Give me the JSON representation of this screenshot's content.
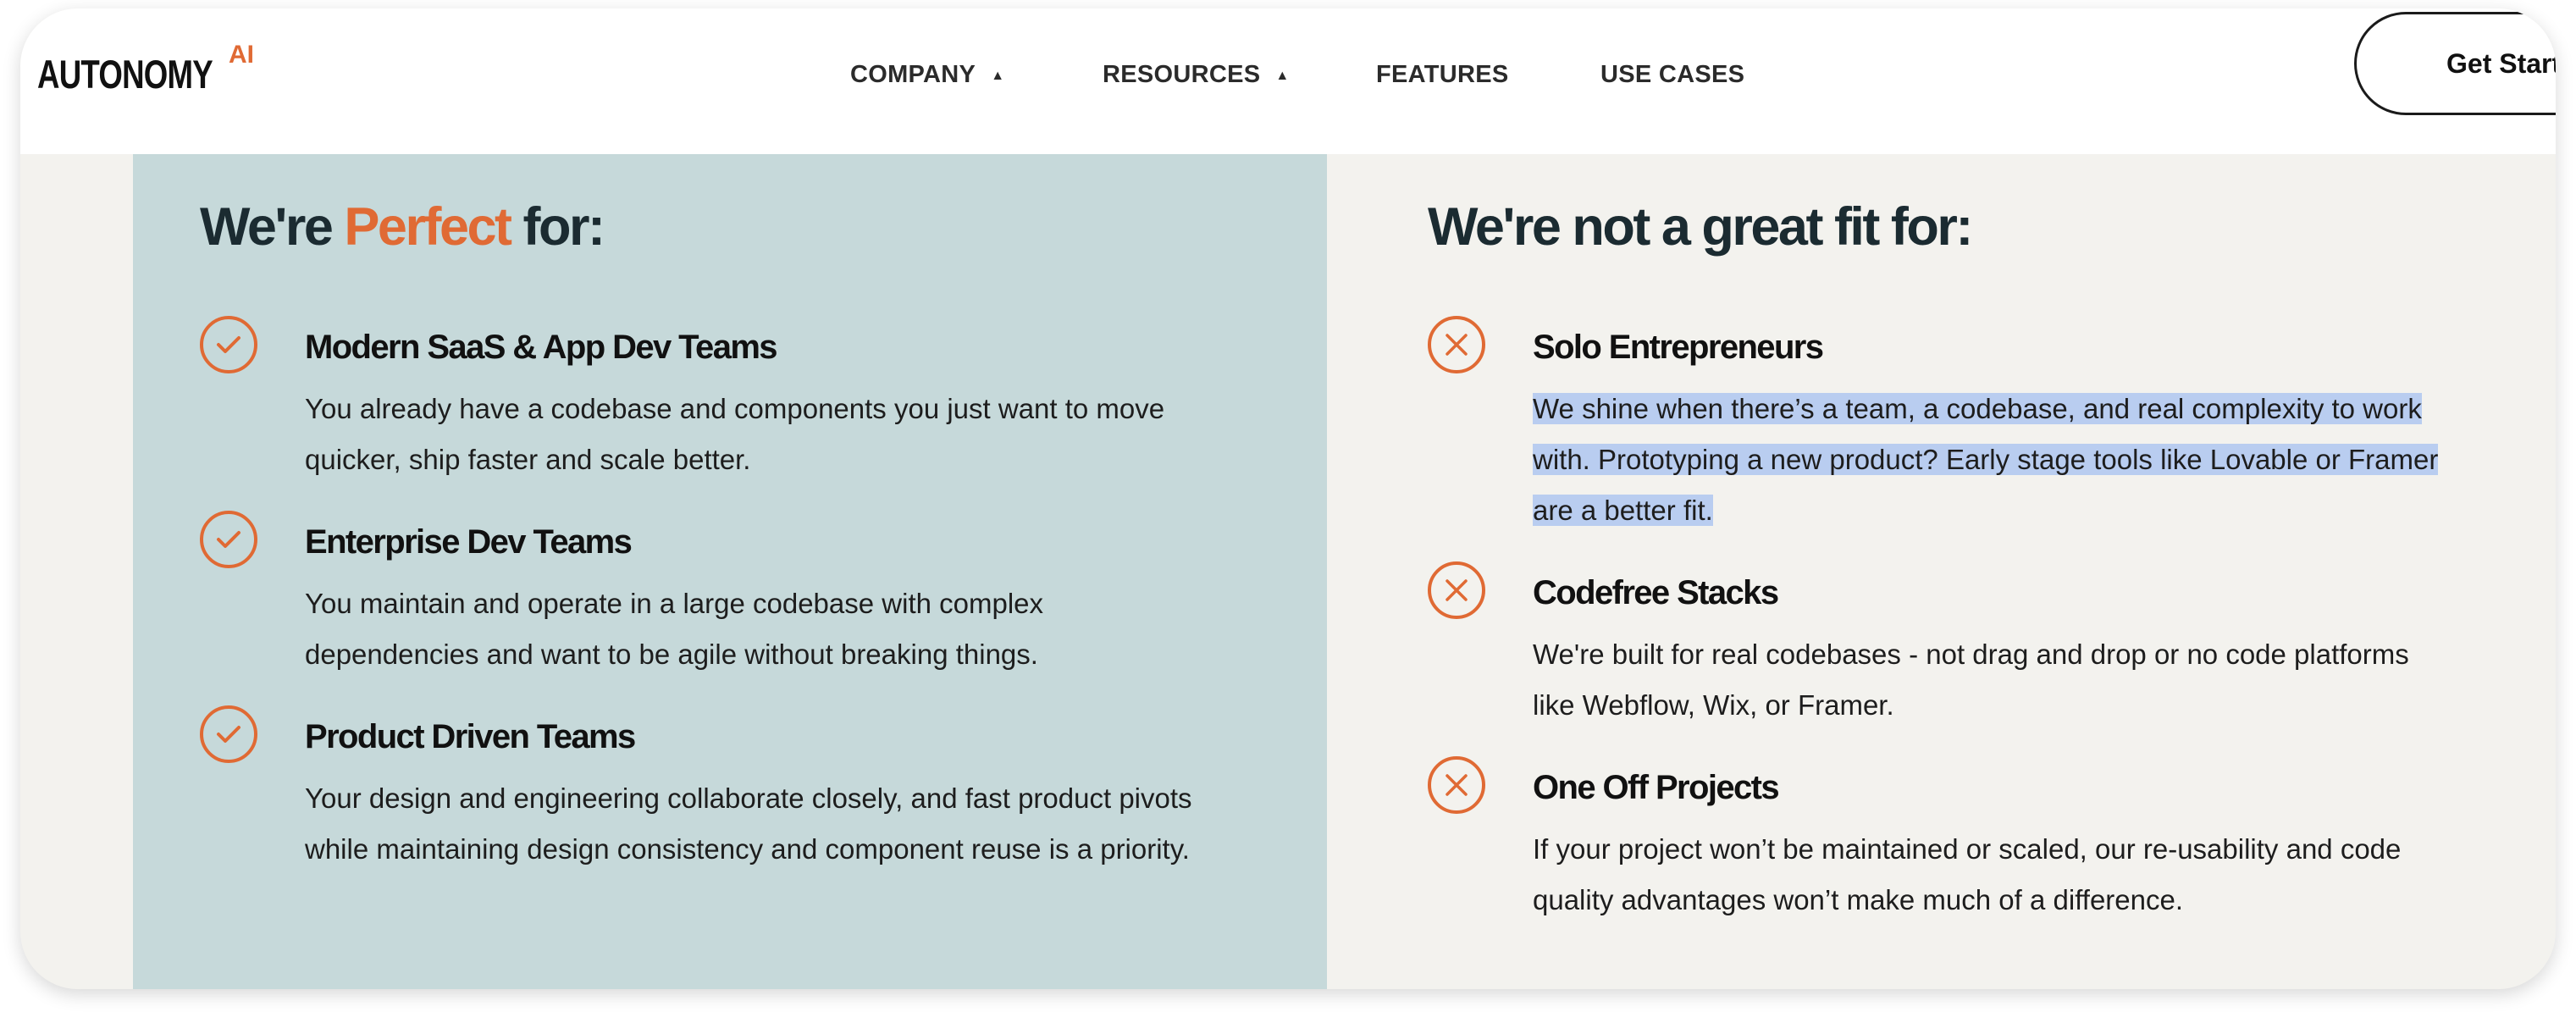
{
  "brand": {
    "name": "AUTONOMY",
    "superscript": "AI"
  },
  "nav": {
    "items": [
      {
        "label": "COMPANY",
        "dropdown": true
      },
      {
        "label": "RESOURCES",
        "dropdown": true
      },
      {
        "label": "FEATURES",
        "dropdown": false
      },
      {
        "label": "USE CASES",
        "dropdown": false
      }
    ],
    "cta_label": "Get Started"
  },
  "perfect_for": {
    "title_pre": "We're ",
    "title_accent": "Perfect",
    "title_post": " for:",
    "items": [
      {
        "icon": "check-circle-icon",
        "title": "Modern SaaS & App Dev Teams",
        "lines": [
          "You already have a codebase and components you just want to move",
          "quicker, ship faster and scale better."
        ]
      },
      {
        "icon": "check-circle-icon",
        "title": "Enterprise Dev Teams",
        "lines": [
          "You maintain and operate in a large codebase with complex",
          "dependencies and want to be agile without breaking things."
        ]
      },
      {
        "icon": "check-circle-icon",
        "title": "Product Driven Teams",
        "lines": [
          "Your design and engineering collaborate closely, and fast product pivots",
          "while maintaining design consistency and component reuse is a priority."
        ]
      }
    ]
  },
  "not_fit_for": {
    "title": "We're not a great fit for:",
    "items": [
      {
        "icon": "x-circle-icon",
        "title": "Solo Entrepreneurs",
        "selected": true,
        "lines": [
          "We shine when there’s a team, a codebase, and real complexity to work",
          "with. Prototyping a new product? Early stage tools like Lovable or Framer",
          "are a better fit."
        ]
      },
      {
        "icon": "x-circle-icon",
        "title": "Codefree Stacks",
        "selected": false,
        "lines": [
          "We're built for real codebases - not drag and drop or no code platforms",
          "like Webflow, Wix, or Framer."
        ]
      },
      {
        "icon": "x-circle-icon",
        "title": "One Off Projects",
        "selected": false,
        "lines": [
          "If your project won’t be maintained or scaled, our re-usability and code",
          "quality advantages won’t make much of a difference."
        ]
      }
    ]
  },
  "colors": {
    "accent": "#e06a34",
    "left_panel": "#c6d9da",
    "right_panel": "#f3f2ee",
    "selection": "#b9cdf0"
  }
}
